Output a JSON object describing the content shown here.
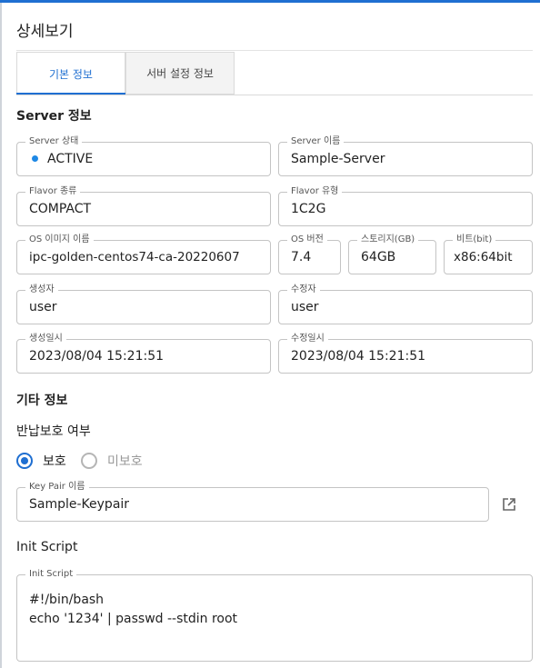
{
  "header": {
    "title": "상세보기"
  },
  "tabs": [
    {
      "label": "기본 정보",
      "active": true
    },
    {
      "label": "서버 설정 정보",
      "active": false
    }
  ],
  "server_section": {
    "title": "Server 정보",
    "status": {
      "label": "Server 상태",
      "value": "ACTIVE",
      "color": "#1e88e5"
    },
    "name": {
      "label": "Server 이름",
      "value": "Sample-Server"
    },
    "flavor_kind": {
      "label": "Flavor 종류",
      "value": "COMPACT"
    },
    "flavor_type": {
      "label": "Flavor 유형",
      "value": "1C2G"
    },
    "os_image": {
      "label": "OS 이미지 이름",
      "value": "ipc-golden-centos74-ca-20220607"
    },
    "os_version": {
      "label": "OS 버전",
      "value": "7.4"
    },
    "storage": {
      "label": "스토리지(GB)",
      "value": "64GB"
    },
    "bit": {
      "label": "비트(bit)",
      "value": "x86:64bit"
    },
    "creator": {
      "label": "생성자",
      "value": "user"
    },
    "modifier": {
      "label": "수정자",
      "value": "user"
    },
    "created_at": {
      "label": "생성일시",
      "value": "2023/08/04 15:21:51"
    },
    "modified_at": {
      "label": "수정일시",
      "value": "2023/08/04 15:21:51"
    }
  },
  "other_section": {
    "title": "기타 정보",
    "protection": {
      "label": "반납보호 여부",
      "options": [
        {
          "label": "보호",
          "selected": true
        },
        {
          "label": "미보호",
          "selected": false
        }
      ]
    },
    "keypair": {
      "label": "Key Pair 이름",
      "value": "Sample-Keypair"
    },
    "init_script": {
      "heading": "Init Script",
      "label": "Init Script",
      "lines": [
        "#!/bin/bash",
        "echo '1234' | passwd --stdin root"
      ]
    }
  },
  "colors": {
    "accent": "#1f6fd1",
    "border": "#c4c4c4"
  },
  "icons": {
    "keypair_link": "external-link-icon"
  }
}
